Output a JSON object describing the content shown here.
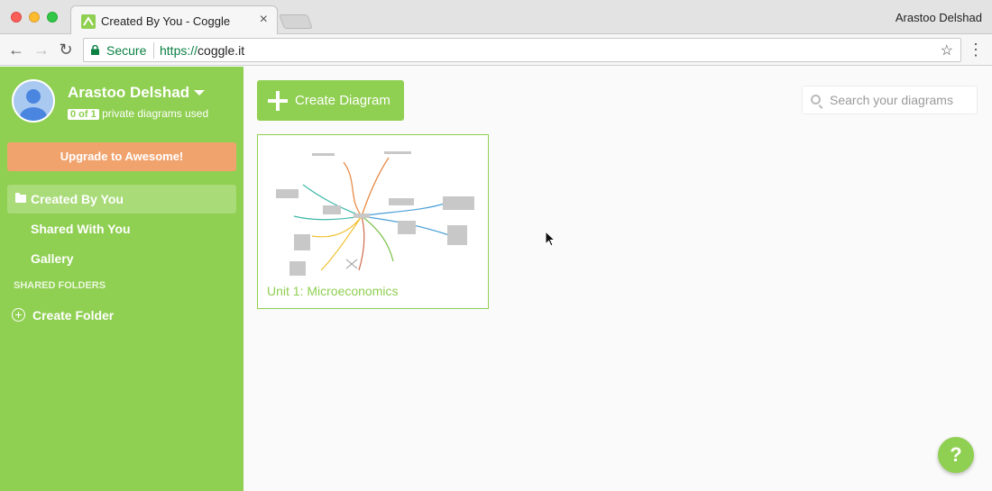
{
  "browser": {
    "tab_title": "Created By You - Coggle",
    "tab_close": "×",
    "profile_name": "Arastoo Delshad",
    "secure_label": "Secure",
    "url_scheme": "https://",
    "url_host": "coggle.it",
    "back_icon": "←",
    "forward_icon": "→",
    "reload_icon": "↻",
    "star_icon": "☆",
    "menu_icon": "⋮"
  },
  "sidebar": {
    "user_name": "Arastoo Delshad",
    "usage_badge": "0 of 1",
    "usage_text": "private diagrams used",
    "upgrade_label": "Upgrade to Awesome!",
    "items": [
      {
        "label": "Created By You",
        "active": true
      },
      {
        "label": "Shared With You",
        "active": false
      },
      {
        "label": "Gallery",
        "active": false
      }
    ],
    "section_label": "SHARED FOLDERS",
    "create_folder_label": "Create Folder"
  },
  "main": {
    "create_label": "Create Diagram",
    "search_placeholder": "Search your diagrams",
    "diagrams": [
      {
        "title": "Unit 1: Microeconomics"
      }
    ]
  },
  "help_label": "?",
  "colors": {
    "brand_green": "#8fcf51",
    "upgrade_orange": "#f1a36e",
    "secure_green": "#0b8043"
  }
}
